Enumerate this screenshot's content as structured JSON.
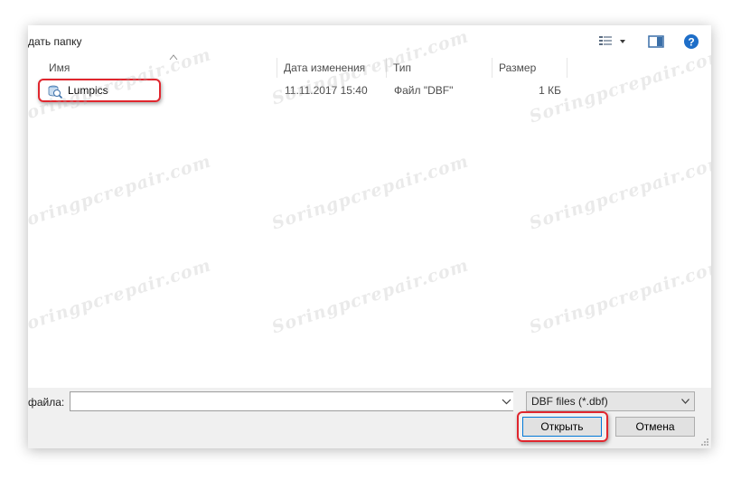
{
  "toolbar": {
    "new_folder_label": "дать папку",
    "views_icon": "view-details-icon",
    "preview_icon": "preview-pane-icon",
    "help_icon": "help-icon"
  },
  "columns": {
    "name": "Имя",
    "date": "Дата изменения",
    "type": "Тип",
    "size": "Размер"
  },
  "files": [
    {
      "name": "Lumpics",
      "date": "11.11.2017 15:40",
      "type": "Файл \"DBF\"",
      "size": "1 КБ",
      "icon": "dbf-file-icon"
    }
  ],
  "watermark": "Soringpcrepair.com",
  "bottom": {
    "filename_label": "файла:",
    "filename_value": "",
    "filter_value": "DBF files (*.dbf)",
    "open_label": "Открыть",
    "cancel_label": "Отмена"
  },
  "colors": {
    "highlight": "#e0262e",
    "accent": "#0078d7",
    "help_blue": "#1e6ec8"
  }
}
